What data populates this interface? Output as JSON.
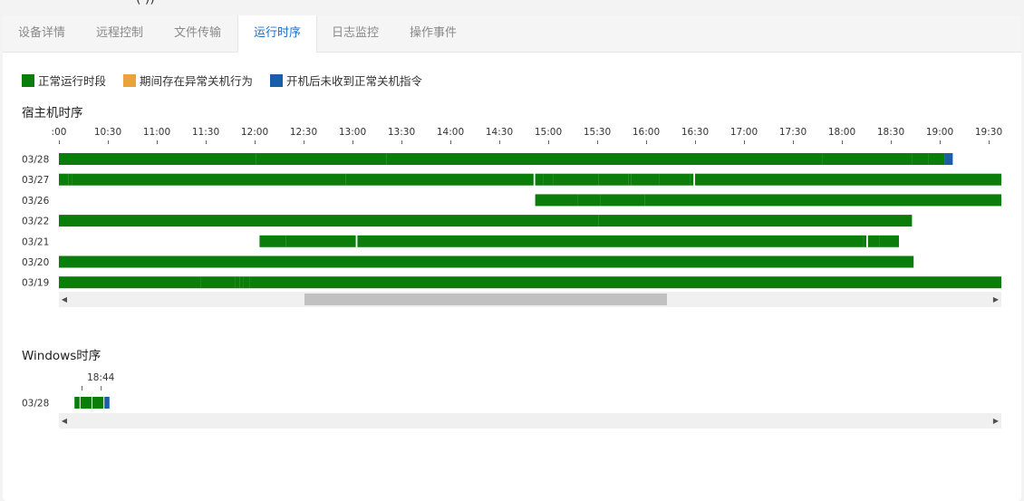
{
  "header": {
    "title_fragment": "(                        ))"
  },
  "tabs": [
    {
      "label": "设备详情",
      "active": false
    },
    {
      "label": "远程控制",
      "active": false
    },
    {
      "label": "文件传输",
      "active": false
    },
    {
      "label": "运行时序",
      "active": true
    },
    {
      "label": "日志监控",
      "active": false
    },
    {
      "label": "操作事件",
      "active": false
    }
  ],
  "legend": [
    {
      "label": "正常运行时段",
      "color": "#0a7d0a"
    },
    {
      "label": "期间存在异常关机行为",
      "color": "#e8a33d"
    },
    {
      "label": "开机后未收到正常关机指令",
      "color": "#1a5ea8"
    }
  ],
  "host_section": {
    "title": "宿主机时序",
    "ticks": [
      ":00",
      "10:30",
      "11:00",
      "11:30",
      "12:00",
      "12:30",
      "13:00",
      "13:30",
      "14:00",
      "14:30",
      "15:00",
      "15:30",
      "16:00",
      "16:30",
      "17:00",
      "17:30",
      "18:00",
      "18:30",
      "19:00",
      "19:30"
    ],
    "rows": [
      {
        "date": "03/28",
        "segments": [
          {
            "start": "10:00",
            "end": "12:00",
            "status": "normal"
          },
          {
            "start": "12:01",
            "end": "13:14",
            "status": "normal"
          },
          {
            "start": "13:15",
            "end": "13:20",
            "status": "normal"
          },
          {
            "start": "13:21",
            "end": "17:47",
            "status": "normal"
          },
          {
            "start": "17:48",
            "end": "18:42",
            "status": "normal"
          },
          {
            "start": "18:43",
            "end": "18:52",
            "status": "normal"
          },
          {
            "start": "18:53",
            "end": "19:02",
            "status": "normal"
          },
          {
            "start": "19:03",
            "end": "19:07",
            "status": "no-shutdown"
          }
        ]
      },
      {
        "date": "03/27",
        "segments": [
          {
            "start": "10:00",
            "end": "10:05",
            "status": "normal"
          },
          {
            "start": "10:06",
            "end": "10:07",
            "status": "normal"
          },
          {
            "start": "10:08",
            "end": "12:55",
            "status": "normal"
          },
          {
            "start": "12:56",
            "end": "14:50",
            "status": "normal"
          },
          {
            "start": "14:52",
            "end": "14:56",
            "status": "normal"
          },
          {
            "start": "14:57",
            "end": "15:02",
            "status": "normal"
          },
          {
            "start": "15:03",
            "end": "15:30",
            "status": "normal"
          },
          {
            "start": "15:31",
            "end": "15:48",
            "status": "normal"
          },
          {
            "start": "15:49",
            "end": "15:50",
            "status": "normal"
          },
          {
            "start": "15:51",
            "end": "16:07",
            "status": "normal"
          },
          {
            "start": "16:08",
            "end": "16:09",
            "status": "normal"
          },
          {
            "start": "16:10",
            "end": "16:26",
            "status": "normal"
          },
          {
            "start": "16:27",
            "end": "16:28",
            "status": "normal"
          },
          {
            "start": "16:30",
            "end": "19:59",
            "status": "normal"
          }
        ]
      },
      {
        "date": "03/26",
        "segments": [
          {
            "start": "14:52",
            "end": "15:14",
            "status": "normal"
          },
          {
            "start": "15:15",
            "end": "15:17",
            "status": "normal"
          },
          {
            "start": "15:18",
            "end": "15:24",
            "status": "normal"
          },
          {
            "start": "15:25",
            "end": "15:31",
            "status": "normal"
          },
          {
            "start": "15:32",
            "end": "15:58",
            "status": "normal"
          },
          {
            "start": "15:59",
            "end": "19:59",
            "status": "normal"
          }
        ]
      },
      {
        "date": "03/22",
        "segments": [
          {
            "start": "10:00",
            "end": "15:30",
            "status": "normal"
          },
          {
            "start": "15:31",
            "end": "18:42",
            "status": "normal"
          }
        ]
      },
      {
        "date": "03/21",
        "segments": [
          {
            "start": "12:03",
            "end": "12:18",
            "status": "normal"
          },
          {
            "start": "12:19",
            "end": "12:59",
            "status": "normal"
          },
          {
            "start": "13:00",
            "end": "13:01",
            "status": "normal"
          },
          {
            "start": "13:03",
            "end": "13:04",
            "status": "normal"
          },
          {
            "start": "13:05",
            "end": "18:12",
            "status": "normal"
          },
          {
            "start": "18:13",
            "end": "18:14",
            "status": "normal"
          },
          {
            "start": "18:16",
            "end": "18:22",
            "status": "normal"
          },
          {
            "start": "18:23",
            "end": "18:34",
            "status": "normal"
          }
        ]
      },
      {
        "date": "03/20",
        "segments": [
          {
            "start": "10:00",
            "end": "18:43",
            "status": "normal"
          }
        ]
      },
      {
        "date": "03/19",
        "segments": [
          {
            "start": "10:00",
            "end": "11:26",
            "status": "normal"
          },
          {
            "start": "11:27",
            "end": "11:44",
            "status": "normal"
          },
          {
            "start": "11:45",
            "end": "11:47",
            "status": "normal"
          },
          {
            "start": "11:48",
            "end": "11:50",
            "status": "normal"
          },
          {
            "start": "11:51",
            "end": "11:52",
            "status": "normal"
          },
          {
            "start": "11:53",
            "end": "11:54",
            "status": "normal"
          },
          {
            "start": "11:55",
            "end": "11:56",
            "status": "normal"
          },
          {
            "start": "11:57",
            "end": "19:59",
            "status": "normal"
          }
        ]
      }
    ],
    "scroll_position": 0.42
  },
  "windows_section": {
    "title": "Windows时序",
    "ticks": [
      "18:44"
    ],
    "rows": [
      {
        "date": "03/28",
        "segments": [
          {
            "start": "18:39",
            "end": "18:39",
            "status": "normal"
          },
          {
            "start": "18:40",
            "end": "18:41",
            "status": "normal"
          },
          {
            "start": "18:42",
            "end": "18:43",
            "status": "normal"
          },
          {
            "start": "18:44",
            "end": "18:44",
            "status": "no-shutdown"
          }
        ]
      }
    ]
  },
  "status_colors": {
    "normal": "#0a7d0a",
    "abnormal": "#e8a33d",
    "no-shutdown": "#1a5ea8"
  }
}
